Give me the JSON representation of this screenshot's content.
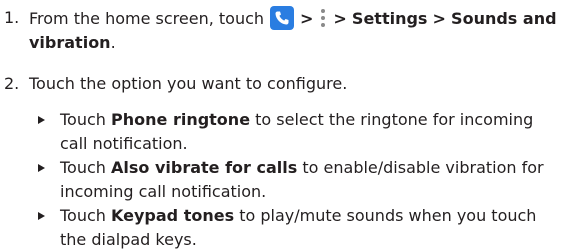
{
  "steps": [
    {
      "number": "1.",
      "prefix": "From the home screen, touch",
      "sep1": ">",
      "sep2": ">",
      "settings": "Settings",
      "sep3": ">",
      "sounds": "Sounds and vibration",
      "period": "."
    },
    {
      "number": "2.",
      "text": "Touch the option you want to configure."
    }
  ],
  "bullets": [
    {
      "touch": "Touch",
      "bold": "Phone ringtone",
      "rest": "to select the ringtone for incoming call notification."
    },
    {
      "touch": "Touch",
      "bold": "Also vibrate for calls",
      "rest": "to enable/disable vibration for incoming call notification."
    },
    {
      "touch": "Touch",
      "bold": "Keypad tones",
      "rest": "to play/mute sounds when you touch the dialpad keys."
    }
  ],
  "icons": {
    "phone": "phone-app-icon",
    "more": "more-options-icon"
  },
  "colors": {
    "text": "#231f20",
    "phone_icon_bg": "#2a7de1",
    "more_icon": "#8a8a8a"
  }
}
